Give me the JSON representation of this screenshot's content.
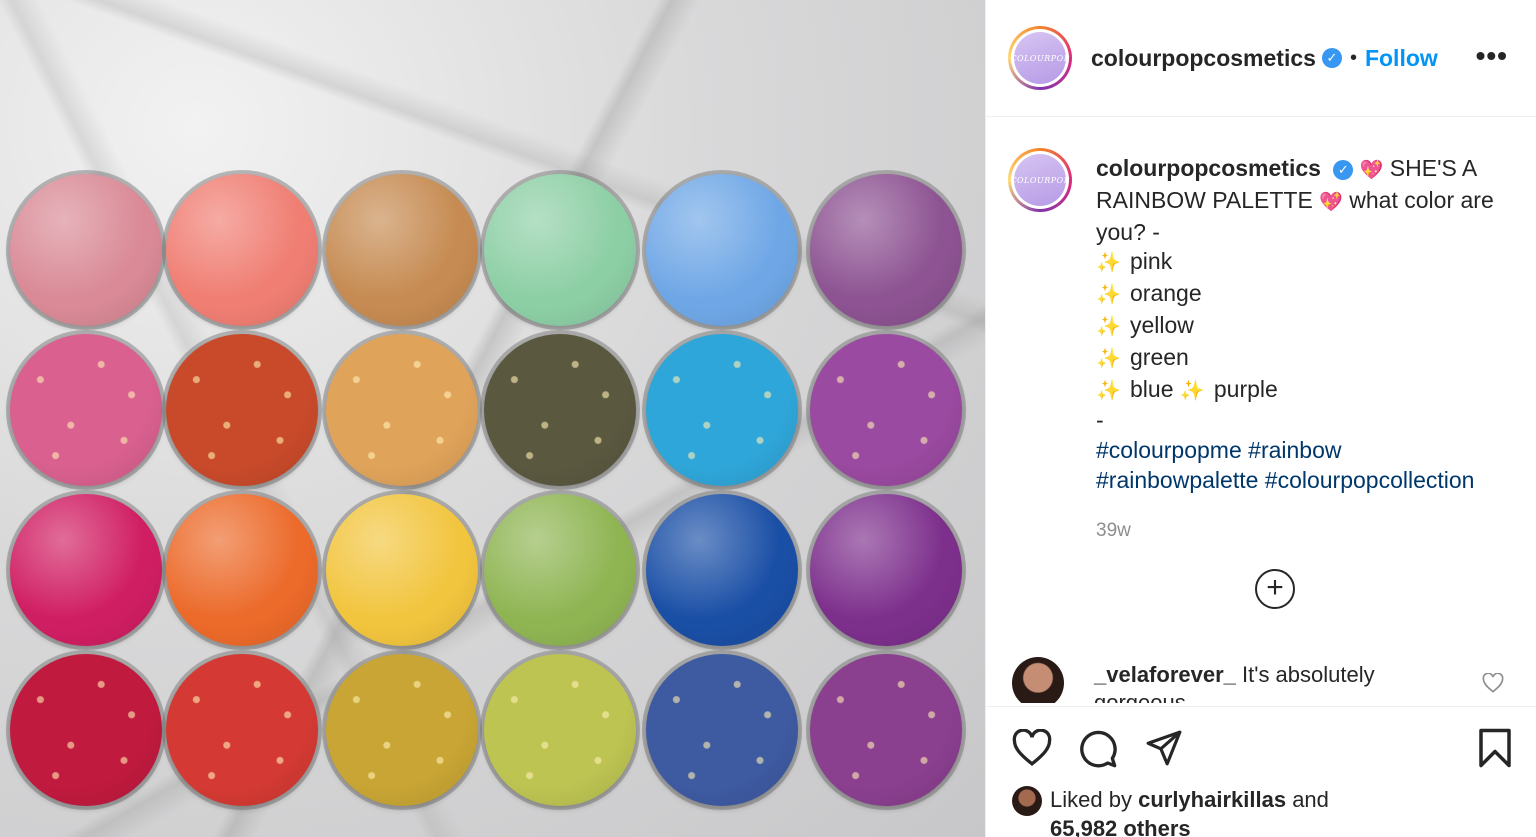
{
  "post": {
    "username": "colourpopcosmetics",
    "avatar_text": "COLOURPOP",
    "separator": "•",
    "follow_label": "Follow",
    "more_label": "•••"
  },
  "caption": {
    "username": "colourpopcosmetics",
    "intro_text": "SHE'S A RAINBOW PALETTE",
    "question_text": "what color are you? -",
    "colors": [
      "pink",
      "orange",
      "yellow",
      "green",
      "blue"
    ],
    "last_color": "purple",
    "dash": "-",
    "hashtags_line1": "#colourpopme #rainbow",
    "hashtags_line2": "#rainbowpalette #colourpopcollection",
    "time_ago": "39w"
  },
  "comment": {
    "username": "_velaforever_",
    "text": "It's absolutely gorgeous"
  },
  "likes": {
    "prefix": "Liked by",
    "user": "curlyhairkillas",
    "suffix": "and",
    "others": "65,982 others"
  },
  "icons": {
    "verified": "verified-badge-icon",
    "heart_emoji": "sparkling-heart-icon",
    "sparkles": "sparkles-icon",
    "add": "add-comment-icon",
    "like": "heart-icon",
    "comment": "speech-bubble-icon",
    "share": "paper-plane-icon",
    "save": "bookmark-icon"
  },
  "palette": {
    "shades": [
      [
        "#d98a96",
        "#f07e73",
        "#c68b52",
        "#8dcfa5",
        "#6fa7e6",
        "#8d5392"
      ],
      [
        "#d9608f",
        "#c84a2a",
        "#e0a35a",
        "#5b5840",
        "#2fa6d9",
        "#9a4aa0"
      ],
      [
        "#d01e63",
        "#ec6a2a",
        "#f2c53e",
        "#8fb553",
        "#1a4fa6",
        "#7d2f8c"
      ],
      [
        "#c01a3e",
        "#d43a33",
        "#c8a534",
        "#bdc452",
        "#3e5aa1",
        "#8a3f8f"
      ]
    ]
  },
  "colors": {
    "link_blue": "#0095f6",
    "hashtag_blue": "#00376b",
    "text": "#262626",
    "muted": "#8e8e8e"
  }
}
